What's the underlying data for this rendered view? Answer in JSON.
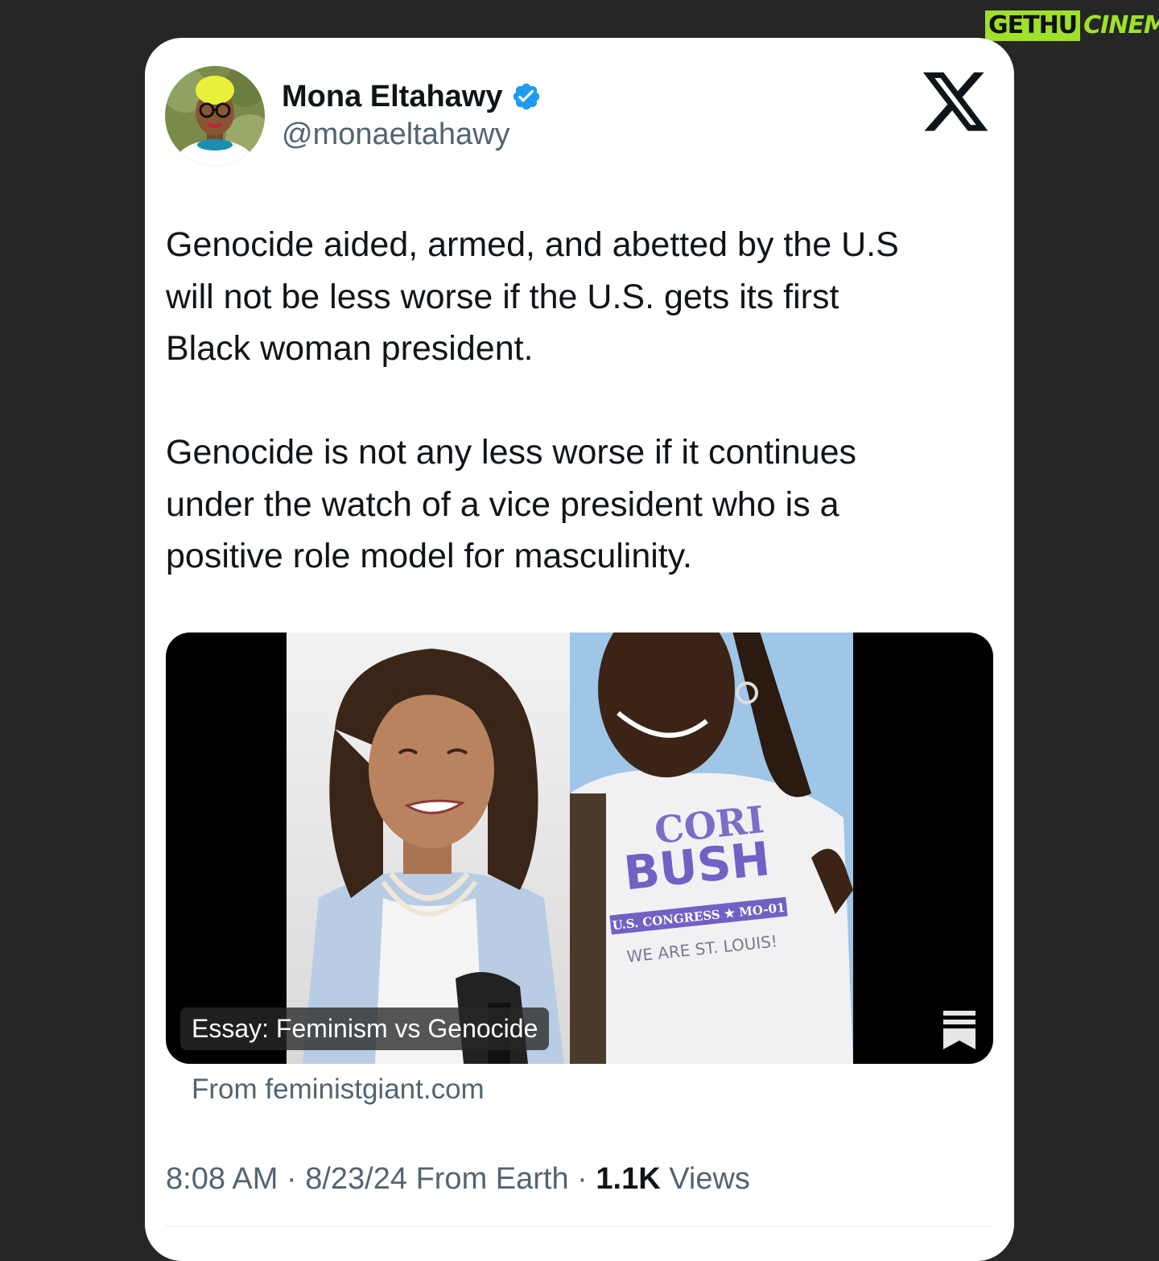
{
  "watermark": {
    "part1": "GETHU",
    "part2": "CINEMA"
  },
  "author": {
    "name": "Mona Eltahawy",
    "handle": "@monaeltahawy",
    "verified": true,
    "verified_color": "#1d9bf0"
  },
  "platform_icon": "x-logo-icon",
  "tweet": {
    "paragraph1": "Genocide aided, armed, and abetted by the U.S\nwill not be less worse if the U.S. gets its first\nBlack woman president.",
    "paragraph2": "Genocide is not any less worse if it continues\nunder the watch of a vice president who is a\npositive role model for masculinity."
  },
  "link_card": {
    "title": "Essay: Feminism vs Genocide",
    "source": "From feministgiant.com",
    "shirt_line1": "CORI",
    "shirt_line2": "BUSH",
    "shirt_line3": "U.S. CONGRESS ★ MO-01",
    "shirt_line4": "WE ARE ST. LOUIS!"
  },
  "meta": {
    "time": "8:08 AM",
    "date": "8/23/24",
    "location": "From Earth",
    "views_count": "1.1K",
    "views_label": "Views"
  }
}
